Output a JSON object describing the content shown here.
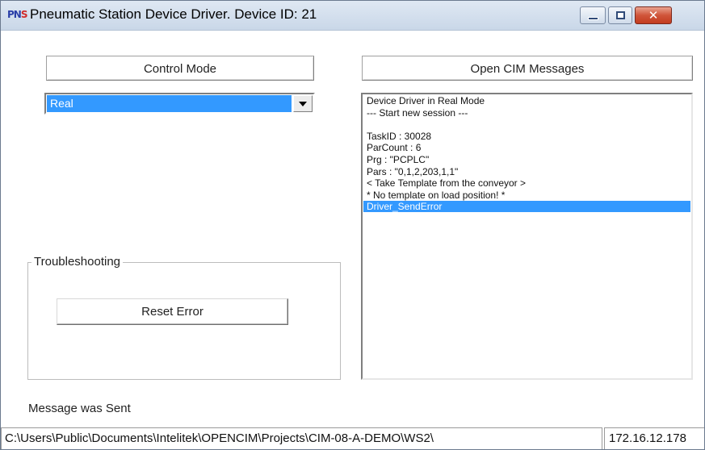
{
  "window": {
    "icon_text": "PNS",
    "title": "Pneumatic Station Device Driver.  Device ID: 21",
    "controls": {
      "minimize": "minimize-icon",
      "maximize": "maximize-icon",
      "close": "close-icon"
    }
  },
  "control_mode": {
    "header": "Control Mode",
    "selected": "Real"
  },
  "messages": {
    "header": "Open CIM Messages",
    "lines": [
      "Device Driver in Real Mode",
      "--- Start new session ---",
      "",
      "TaskID : 30028",
      "ParCount : 6",
      "Prg : \"PCPLC\"",
      "Pars : \"0,1,2,203,1,1\"",
      "< Take Template from the conveyor >",
      "* No template on load position! *",
      "Driver_SendError"
    ],
    "selected_index": 9
  },
  "troubleshooting": {
    "legend": "Troubleshooting",
    "reset_label": "Reset Error"
  },
  "status": {
    "message": "Message was Sent",
    "path": "C:\\Users\\Public\\Documents\\Intelitek\\OPENCIM\\Projects\\CIM-08-A-DEMO\\WS2\\",
    "ip": "172.16.12.178"
  },
  "colors": {
    "selection": "#3399ff",
    "close_button": "#c23b1f"
  }
}
